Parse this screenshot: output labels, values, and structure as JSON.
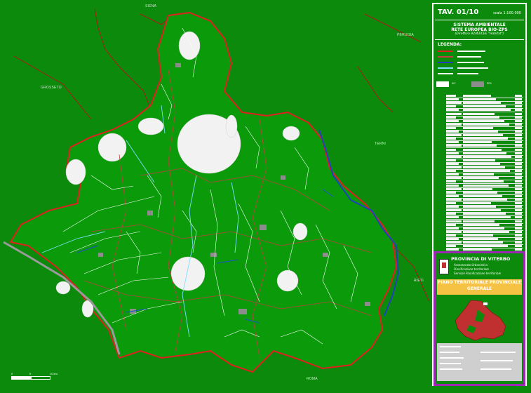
{
  "map": {
    "place_labels": [
      {
        "key": "siena",
        "text": "SIENA"
      },
      {
        "key": "grosseto",
        "text": "GROSSETO"
      },
      {
        "key": "perugia",
        "text": "PERUGIA"
      },
      {
        "key": "terni",
        "text": "TERNI"
      },
      {
        "key": "rieti",
        "text": "RIETI"
      },
      {
        "key": "roma",
        "text": "ROMA"
      }
    ],
    "scale_labels": [
      "0",
      "5",
      "10 km"
    ],
    "colors": {
      "background": "#0c8a0c",
      "province_boundary": "#e02020",
      "municipal_boundary": "#c04040",
      "hydrography": "#ffffff",
      "main_rivers": "#7fdfff",
      "tevere": "#2040c0",
      "sic": "#ffffff",
      "zps": "#8c8c8c"
    }
  },
  "panel": {
    "tav": "TAV. 01/10",
    "scala": "scala 1:100.000",
    "theme_line1": "SISTEMA AMBIENTALE",
    "theme_line2": "RETE EUROPEA BIO-ZPS",
    "theme_line3": "(Direttiva 92/43/CEE \"Habitat\")",
    "legend_title": "LEGENDA:",
    "sic_label": "SIC",
    "zps_label": "ZPS",
    "province_name": "PROVINCIA DI VITERBO",
    "province_lines": [
      "Assessorato Urbanistica",
      "Pianificazione territoriale",
      "Servizio Pianificazione territoriale"
    ],
    "plan_title_1": "PIANO TERRITORIALE PROVINCIALE",
    "plan_title_2": "GENERALE",
    "panel_border": "#ffffff",
    "prov_border": "#9b27b3",
    "plan_bar_color": "#f6c243"
  }
}
